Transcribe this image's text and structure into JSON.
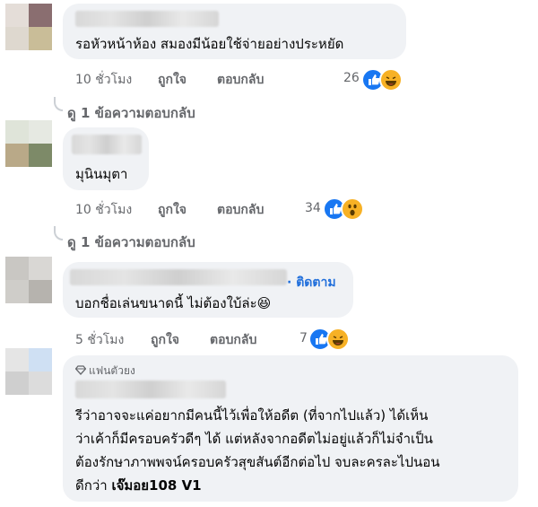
{
  "comments": [
    {
      "text": "รอหัวหน้าห้อง สมองมีน้อยใช้จ่ายอย่างประหยัด",
      "time": "10 ชั่วโมง",
      "like": "ถูกใจ",
      "reply": "ตอบกลับ",
      "reactions_count": "26",
      "reactions": [
        "like-icon",
        "haha-icon"
      ],
      "view_replies": "ดู 1 ข้อความตอบกลับ"
    },
    {
      "text": "มุนินมุตา",
      "time": "10 ชั่วโมง",
      "like": "ถูกใจ",
      "reply": "ตอบกลับ",
      "reactions_count": "34",
      "reactions": [
        "like-icon",
        "wow-icon"
      ],
      "view_replies": "ดู 1 ข้อความตอบกลับ"
    },
    {
      "follow": "· ติดตาม",
      "text": "บอกชื่อเล่นขนาดนี้ ไม่ต้องใบ้ล่ะ😆",
      "time": "5 ชั่วโมง",
      "like": "ถูกใจ",
      "reply": "ตอบกลับ",
      "reactions_count": "7",
      "reactions": [
        "like-icon",
        "haha-icon"
      ]
    },
    {
      "badge": "แฟนตัวยง",
      "lines": [
        "รีว่าอาจจะแค่อยากมีคนนี้ไว้เพื่อให้อดีต (ที่จากไปแล้ว) ได้เห็น",
        "ว่าเค้าก็มีครอบครัวดีๆ ได้ แต่หลังจากอดีตไม่อยู่แล้วก็ไม่จำเป็น",
        "ต้องรักษาภาพพจน์ครอบครัวสุขสันต์อีกต่อไป จบละครละไปนอน"
      ],
      "last_line_plain": "ดีกว่า ",
      "last_line_bold": "เจ๊มอย108 V1"
    }
  ],
  "colors": {
    "bubble": "#f0f2f5",
    "meta": "#65676b",
    "link": "#216fdb",
    "like": "#1877f2",
    "haha": "#f7b125"
  }
}
